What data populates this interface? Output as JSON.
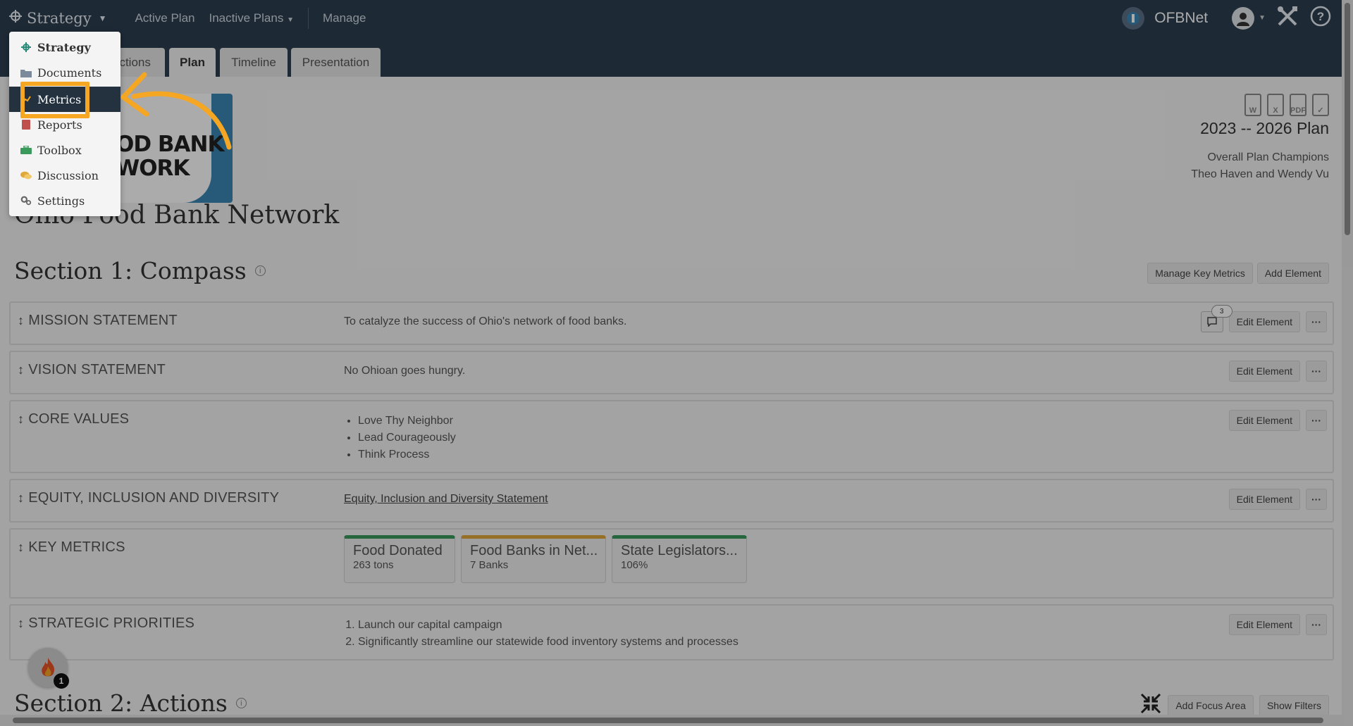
{
  "topbar": {
    "brand": "Strategy",
    "nav": [
      "Active Plan",
      "Inactive Plans",
      "Manage"
    ],
    "org_name": "OFBNet"
  },
  "tabs": [
    {
      "label": "Actions",
      "active": false
    },
    {
      "label": "Plan",
      "active": true
    },
    {
      "label": "Timeline",
      "active": false
    },
    {
      "label": "Presentation",
      "active": false
    }
  ],
  "dropdown": {
    "items": [
      "Strategy",
      "Documents",
      "Metrics",
      "Reports",
      "Toolbox",
      "Discussion",
      "Settings"
    ],
    "selected": "Metrics"
  },
  "header": {
    "logo_text_line1": "OD BANK",
    "logo_text_line2": "WORK",
    "org_title": "Ohio Food Bank Network",
    "plan_years": "2023 -- 2026 Plan",
    "champions_label": "Overall Plan Champions",
    "champions_names": "Theo Haven and Wendy Vu",
    "export_icons": [
      "word-icon",
      "excel-icon",
      "pdf-icon",
      "calendar-icon"
    ]
  },
  "section1": {
    "title": "Section 1: Compass",
    "buttons": {
      "manage_key_metrics": "Manage Key Metrics",
      "add_element": "Add Element"
    },
    "edit_label": "Edit Element",
    "more_label": "···",
    "rows": {
      "mission": {
        "label": "MISSION STATEMENT",
        "text": "To catalyze the success of Ohio's network of food banks.",
        "comment_count": "3"
      },
      "vision": {
        "label": "VISION STATEMENT",
        "text": "No Ohioan goes hungry."
      },
      "core_values": {
        "label": "CORE VALUES",
        "items": [
          "Love Thy Neighbor",
          "Lead Courageously",
          "Think Process"
        ]
      },
      "edi": {
        "label": "EQUITY, INCLUSION AND DIVERSITY",
        "link": "Equity, Inclusion and Diversity Statement"
      },
      "key_metrics": {
        "label": "KEY METRICS",
        "cards": [
          {
            "name": "Food Donated",
            "value": "263 tons",
            "color": "#3a9a5b"
          },
          {
            "name": "Food Banks in Net...",
            "value": "7 Banks",
            "color": "#e0a83a"
          },
          {
            "name": "State Legislators...",
            "value": "106%",
            "color": "#3a9a5b"
          }
        ]
      },
      "priorities": {
        "label": "STRATEGIC PRIORITIES",
        "items": [
          "Launch our capital campaign",
          "Significantly streamline our statewide food inventory systems and processes"
        ]
      }
    }
  },
  "section2": {
    "title": "Section 2: Actions",
    "buttons": {
      "add_focus_area": "Add Focus Area",
      "show_filters": "Show Filters"
    }
  },
  "help_fab": {
    "count": "1"
  },
  "colors": {
    "navbar": "#2c3e50",
    "highlight": "#f5a623",
    "selected_menu": "#24323f"
  }
}
